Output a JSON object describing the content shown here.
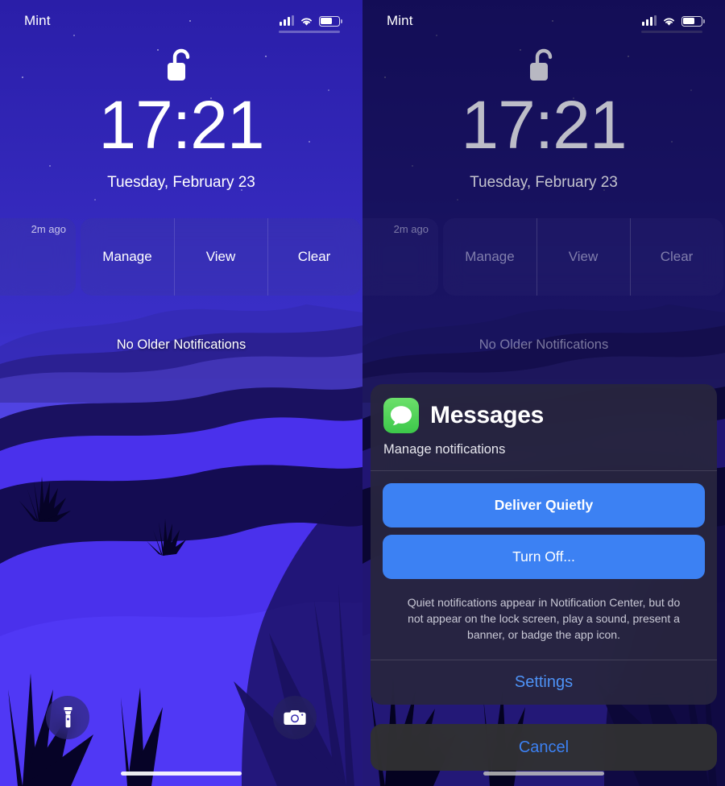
{
  "colors": {
    "accent_blue": "#3c81f3",
    "link_blue": "#4e93f7",
    "messages_green": "#3cc84a",
    "sheet_bg": "#282a3e",
    "cancel_bg": "#303032"
  },
  "panels": [
    {
      "id": "left",
      "dimmed": false,
      "status_bar": {
        "carrier": "Mint",
        "signal_icon": "cellular-signal-icon",
        "wifi_icon": "wifi-icon",
        "battery_icon": "battery-icon"
      },
      "lock_icon": "unlocked-padlock-icon",
      "clock": "17:21",
      "date": "Tuesday, February 23",
      "notification": {
        "age": "2m ago",
        "actions": [
          "Manage",
          "View",
          "Clear"
        ]
      },
      "no_older": "No Older Notifications",
      "quick_actions": [
        {
          "name": "flashlight-icon",
          "label": "Flashlight"
        },
        {
          "name": "camera-icon",
          "label": "Camera"
        }
      ]
    },
    {
      "id": "right",
      "dimmed": true,
      "status_bar": {
        "carrier": "Mint",
        "signal_icon": "cellular-signal-icon",
        "wifi_icon": "wifi-icon",
        "battery_icon": "battery-icon"
      },
      "lock_icon": "unlocked-padlock-icon",
      "clock": "17:21",
      "date": "Tuesday, February 23",
      "notification": {
        "age": "2m ago",
        "actions": [
          "Manage",
          "View",
          "Clear"
        ]
      },
      "no_older": "No Older Notifications",
      "sheet": {
        "app_icon": "messages-app-icon",
        "app_name": "Messages",
        "subtitle": "Manage notifications",
        "primary_button": "Deliver Quietly",
        "secondary_button": "Turn Off...",
        "description": "Quiet notifications appear in Notification Center, but do not appear on the lock screen, play a sound, present a banner, or badge the app icon.",
        "settings_link": "Settings",
        "cancel_button": "Cancel"
      }
    }
  ]
}
